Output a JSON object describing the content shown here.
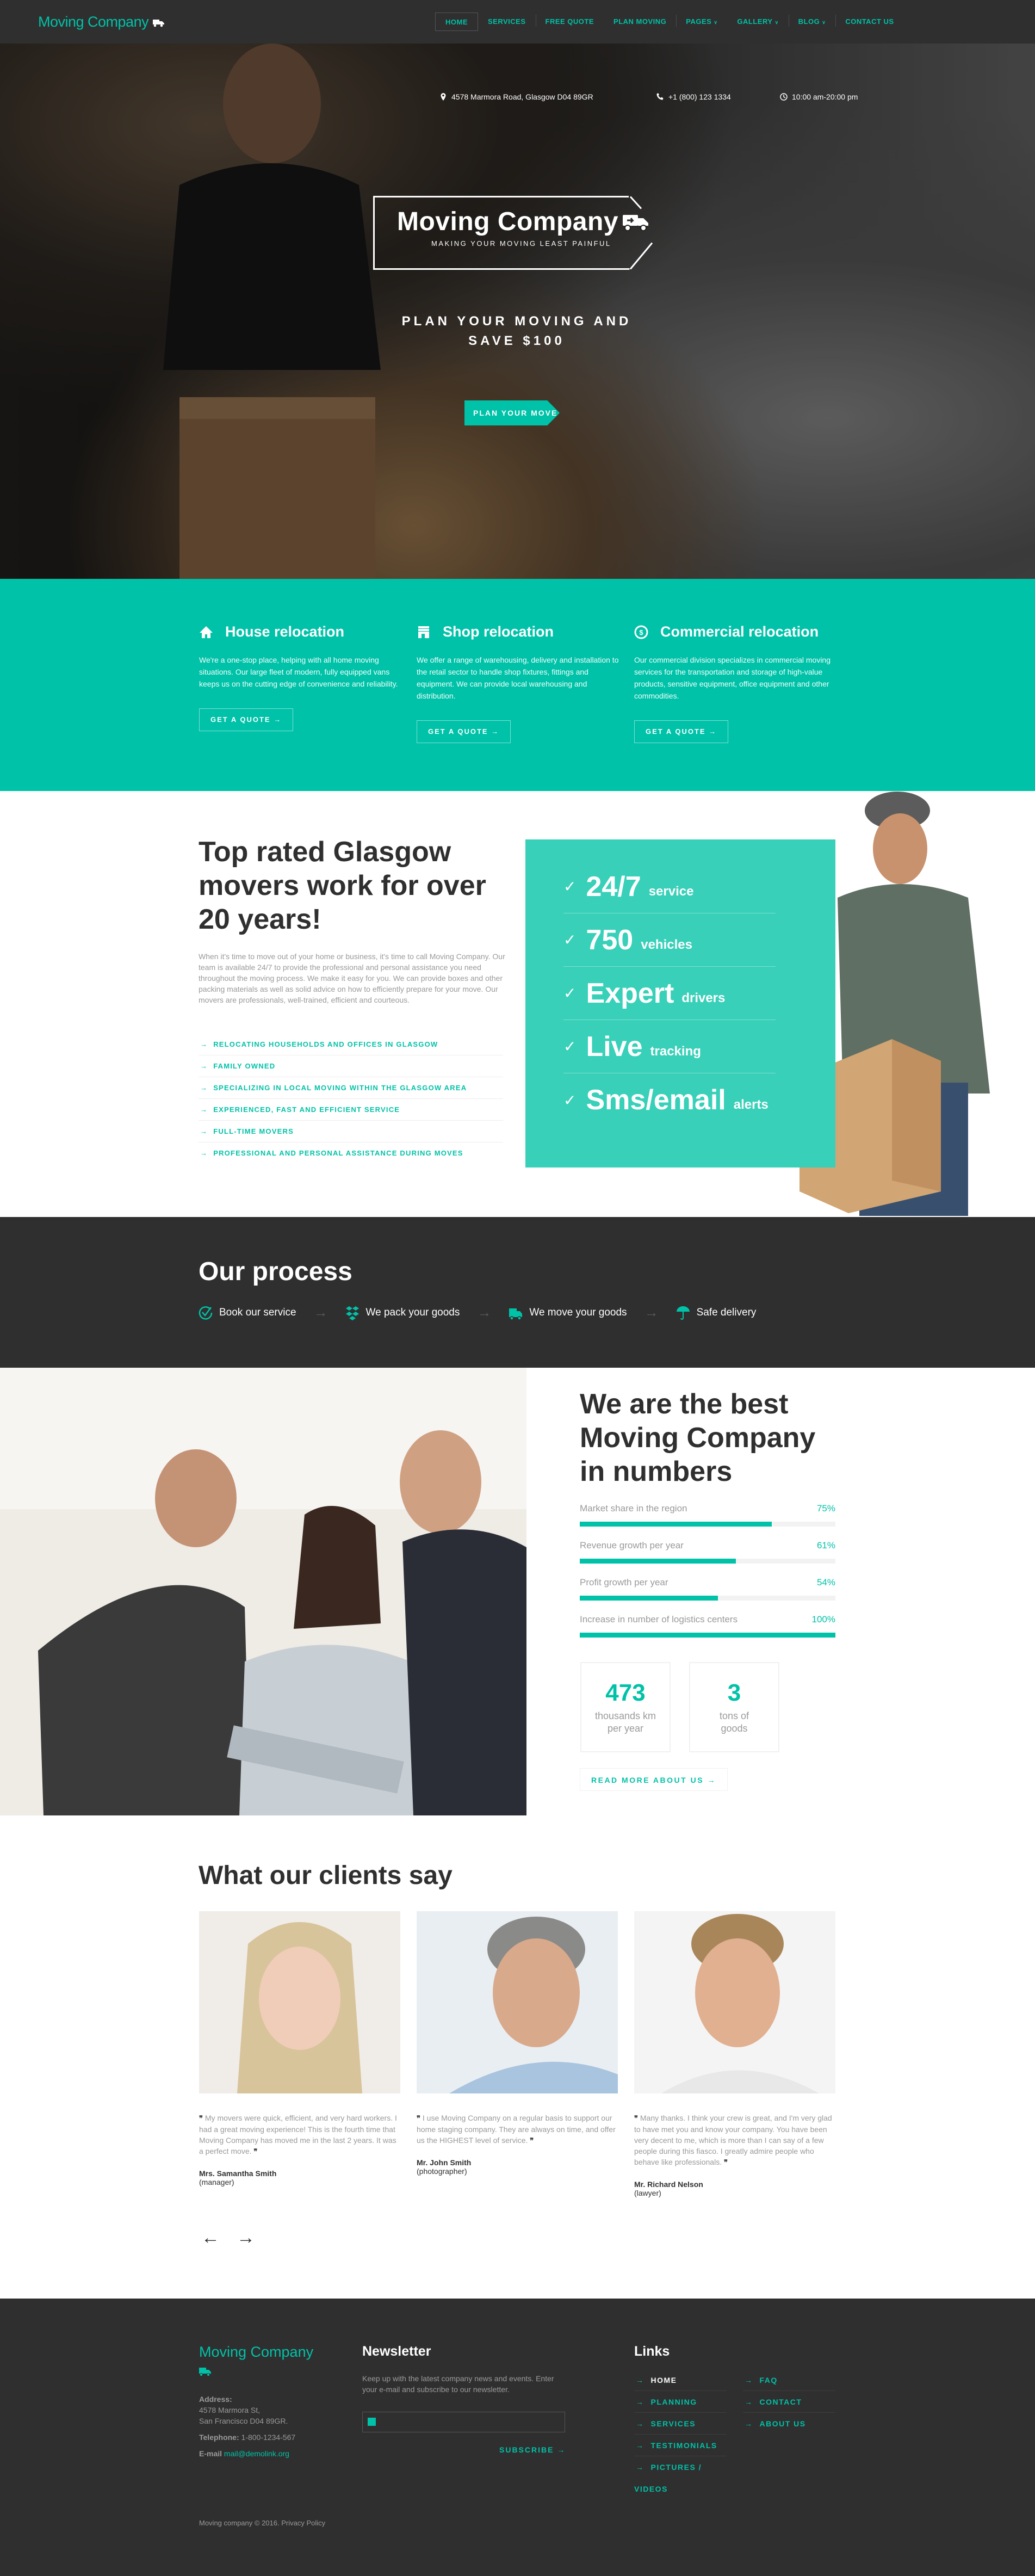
{
  "nav": {
    "logo": "Moving Company",
    "items": [
      {
        "label": "HOME",
        "active": true
      },
      {
        "label": "SERVICES"
      },
      {
        "label": "FREE QUOTE"
      },
      {
        "label": "PLAN MOVING"
      },
      {
        "label": "PAGES",
        "dropdown": true
      },
      {
        "label": "GALLERY",
        "dropdown": true
      },
      {
        "label": "BLOG",
        "dropdown": true
      },
      {
        "label": "CONTACT US"
      }
    ]
  },
  "hero": {
    "address": "4578 Marmora Road, Glasgow D04 89GR",
    "phone": "+1 (800) 123 1334",
    "hours": "10:00 am-20:00 pm",
    "title": "Moving Company",
    "subtitle": "MAKING YOUR MOVING LEAST PAINFUL",
    "cta": "PLAN YOUR MOVING AND SAVE $100",
    "button": "PLAN YOUR MOVE"
  },
  "services": [
    {
      "icon": "home-icon",
      "title": "House relocation",
      "text": "We're a one-stop place, helping with all home moving situations. Our large fleet of modern, fully equipped vans keeps us on the cutting edge of convenience and reliability.",
      "button": "GET A QUOTE"
    },
    {
      "icon": "shop-icon",
      "title": "Shop relocation",
      "text": "We offer a range of warehousing, delivery and installation to the retail sector to handle shop fixtures, fittings and equipment. We can provide local warehousing and distribution.",
      "button": "GET A QUOTE"
    },
    {
      "icon": "dollar-icon",
      "title": "Commercial relocation",
      "text": "Our commercial division specializes in commercial moving services for the transportation and storage of high-value products, sensitive equipment, office equipment and other commodities.",
      "button": "GET A QUOTE"
    }
  ],
  "about": {
    "title": "Top rated Glasgow movers work for over 20 years!",
    "text": "When it's time to move out of your home or business, it's time to call Moving Company. Our team is available 24/7 to provide the professional and personal assistance you need throughout the moving process. We make it easy for you. We can provide boxes and other packing materials as well as solid advice on how to efficiently prepare for your move. Our movers are professionals, well-trained, efficient and courteous.",
    "list": [
      "RELOCATING HOUSEHOLDS AND OFFICES IN GLASGOW",
      "FAMILY OWNED",
      "SPECIALIZING IN LOCAL MOVING WITHIN THE GLASGOW AREA",
      "EXPERIENCED, FAST AND EFFICIENT SERVICE",
      "FULL-TIME MOVERS",
      "PROFESSIONAL AND PERSONAL ASSISTANCE DURING MOVES"
    ],
    "features": [
      {
        "big": "24/7",
        "small": "service"
      },
      {
        "big": "750",
        "small": "vehicles"
      },
      {
        "big": "Expert",
        "small": "drivers"
      },
      {
        "big": "Live",
        "small": "tracking"
      },
      {
        "big": "Sms/email",
        "small": "alerts"
      }
    ]
  },
  "process": {
    "title": "Our process",
    "steps": [
      {
        "icon": "check-circle-icon",
        "label": "Book our service"
      },
      {
        "icon": "box-pack-icon",
        "label": "We pack your goods"
      },
      {
        "icon": "truck-icon",
        "label": "We move your goods"
      },
      {
        "icon": "umbrella-icon",
        "label": "Safe delivery"
      }
    ]
  },
  "numbers": {
    "title": "We are the best Moving Company in numbers",
    "bars": [
      {
        "label": "Market share in the region",
        "value": 75,
        "display": "75%"
      },
      {
        "label": "Revenue growth per year",
        "value": 61,
        "display": "61%"
      },
      {
        "label": "Profit growth per year",
        "value": 54,
        "display": "54%"
      },
      {
        "label": "Increase in number of logistics centers",
        "value": 100,
        "display": "100%"
      }
    ],
    "boxes": [
      {
        "number": "473",
        "text": "thousands km per year"
      },
      {
        "number": "3",
        "text": "tons of goods"
      }
    ],
    "button": "READ MORE ABOUT US"
  },
  "testimonials": {
    "title": "What our clients say",
    "items": [
      {
        "quote": "My movers were quick, efficient, and very hard workers. I had a great moving experience! This is the fourth time that Moving Company has moved me in the last 2 years. It was a perfect move.",
        "name": "Mrs. Samantha Smith",
        "role": "(manager)"
      },
      {
        "quote": "I use Moving Company on a regular basis to support our home staging company. They are always on time, and offer us the HIGHEST level of service.",
        "name": "Mr. John Smith",
        "role": "(photographer)"
      },
      {
        "quote": "Many thanks. I think your crew is great, and I'm very glad to have met you and know your company. You have been very decent to me, which is more than I can say of a few people during this fiasco. I greatly admire people who behave like professionals.",
        "name": "Mr. Richard Nelson",
        "role": "(lawyer)"
      }
    ],
    "prev": "←",
    "next": "→"
  },
  "footer": {
    "logo": "Moving Company",
    "address_label": "Address:",
    "address_line1": "4578 Marmora St,",
    "address_line2": "San Francisco D04 89GR.",
    "telephone_label": "Telephone:",
    "telephone": "1-800-1234-567",
    "email_label": "E-mail",
    "email": "mail@demolink.org",
    "newsletter_title": "Newsletter",
    "newsletter_text": "Keep up with the latest company news and events. Enter your e-mail and subscribe to our newsletter.",
    "email_placeholder": "",
    "subscribe": "SUBSCRIBE",
    "links_title": "Links",
    "links_col1": [
      "HOME",
      "PLANNING",
      "SERVICES",
      "TESTIMONIALS",
      "PICTURES / VIDEOS"
    ],
    "links_col2": [
      "FAQ",
      "CONTACT",
      "ABOUT US"
    ],
    "copyright": "Moving company © 2016. Privacy Policy"
  },
  "colors": {
    "accent": "#00c2a8",
    "dark": "#2f2f2f",
    "feature_panel": "#38d0b8"
  }
}
